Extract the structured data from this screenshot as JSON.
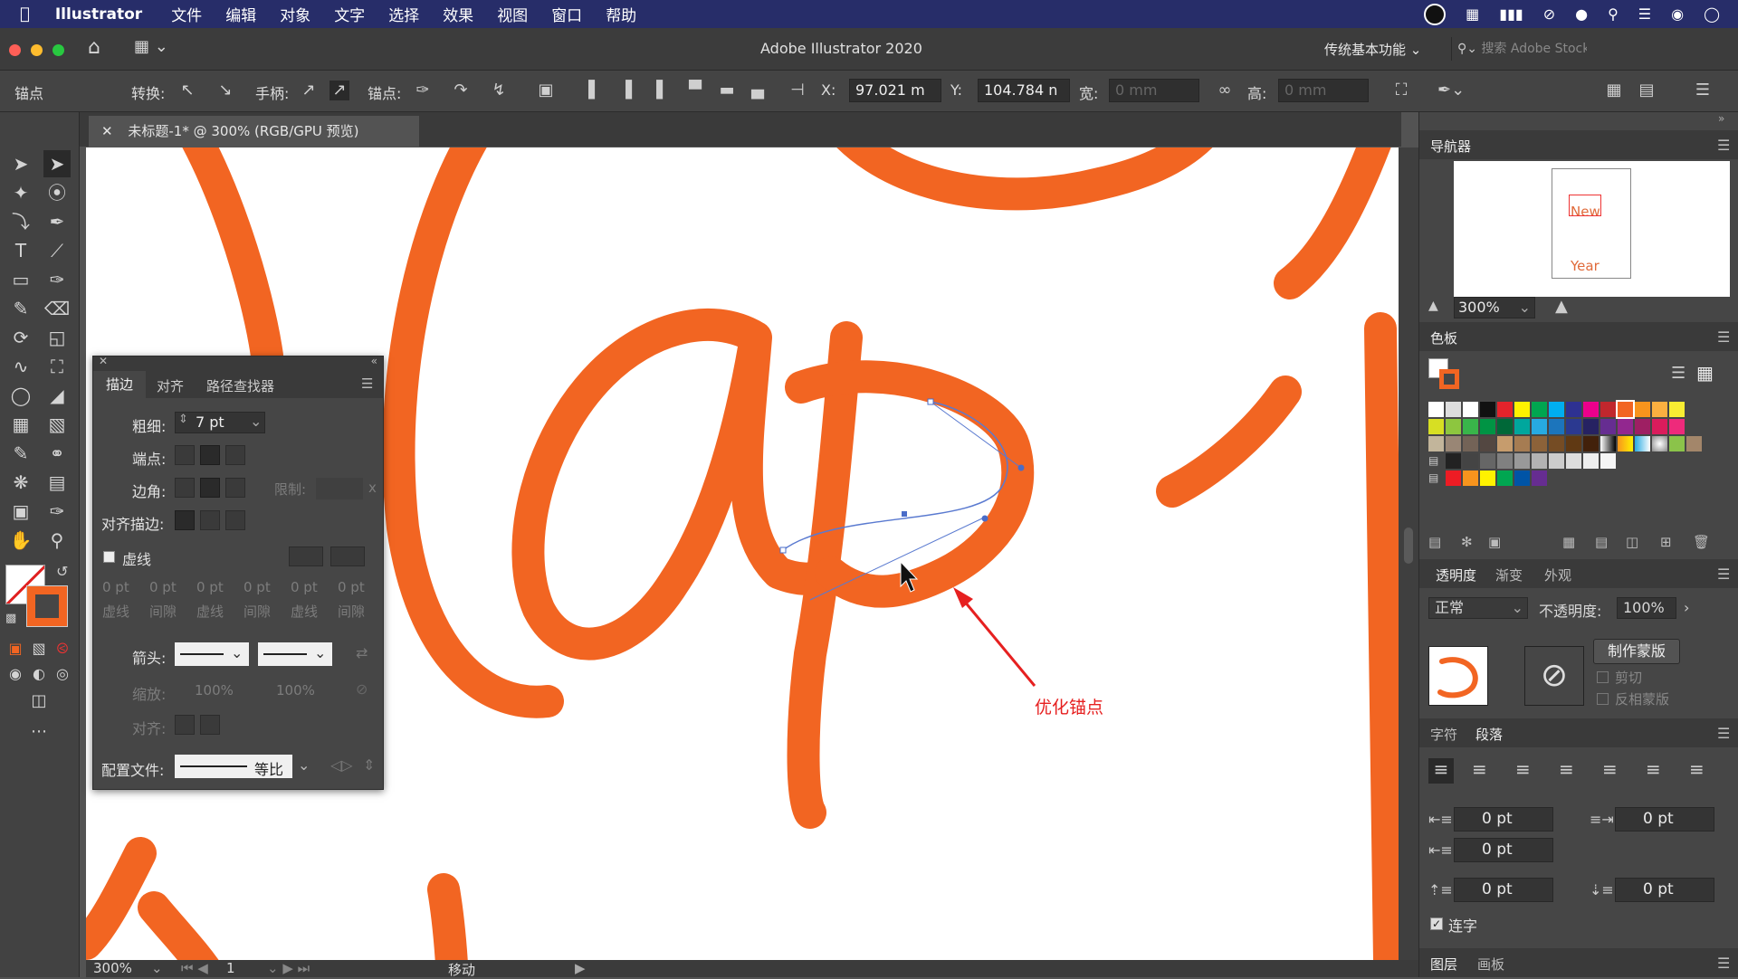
{
  "menubar": {
    "app": "Illustrator",
    "items": [
      "文件",
      "编辑",
      "对象",
      "文字",
      "选择",
      "效果",
      "视图",
      "窗口",
      "帮助"
    ]
  },
  "titlebar": {
    "title": "Adobe Illustrator 2020",
    "workspace": "传统基本功能",
    "search_placeholder": "搜索 Adobe Stock"
  },
  "control": {
    "mode": "锚点",
    "convert": "转换:",
    "handles": "手柄:",
    "anchors": "锚点:",
    "x_label": "X:",
    "x_value": "97.021 m",
    "y_label": "Y:",
    "y_value": "104.784 n",
    "w_label": "宽:",
    "w_value": "0 mm",
    "h_label": "高:",
    "h_value": "0 mm"
  },
  "document": {
    "tab": "未标题-1* @ 300% (RGB/GPU 预览)",
    "annotation": "优化锚点",
    "zoom": "300%",
    "artboard": "1",
    "status": "移动"
  },
  "stroke_panel": {
    "tabs": [
      "描边",
      "对齐",
      "路径查找器"
    ],
    "weight_label": "粗细:",
    "weight_value": "7 pt",
    "cap_label": "端点:",
    "corner_label": "边角:",
    "limit_label": "限制:",
    "limit_unit": "x",
    "align_label": "对齐描边:",
    "dashed_label": "虚线",
    "dash_values": [
      "0 pt",
      "0 pt",
      "0 pt",
      "0 pt",
      "0 pt",
      "0 pt"
    ],
    "dash_labels": [
      "虚线",
      "间隙",
      "虚线",
      "间隙",
      "虚线",
      "间隙"
    ],
    "arrow_label": "箭头:",
    "scale_label": "缩放:",
    "scale_values": [
      "100%",
      "100%"
    ],
    "align_arrow_label": "对齐:",
    "profile_label": "配置文件:",
    "profile_value": "等比"
  },
  "navigator": {
    "title": "导航器",
    "zoom": "300%",
    "thumb_words": [
      "New",
      "Year"
    ]
  },
  "swatches": {
    "title": "色板"
  },
  "transparency": {
    "tabs": [
      "透明度",
      "渐变",
      "外观"
    ],
    "blend": "正常",
    "opacity_label": "不透明度:",
    "opacity_value": "100%",
    "make_mask": "制作蒙版",
    "clip": "剪切",
    "invert": "反相蒙版"
  },
  "paragraph": {
    "tabs": [
      "字符",
      "段落"
    ],
    "values": [
      "0 pt",
      "0 pt",
      "0 pt",
      "0 pt",
      "0 pt"
    ],
    "hyphenate": "连字"
  },
  "bottom_tabs": [
    "图层",
    "画板"
  ],
  "colors": {
    "accent": "#f26522",
    "menubar": "#272d69"
  }
}
